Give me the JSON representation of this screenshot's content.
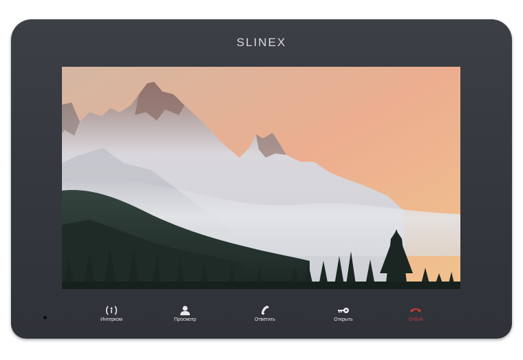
{
  "device": {
    "brand": "SLINEX",
    "body_color": "#36393f"
  },
  "screen": {
    "image": "mountain-landscape-wallpaper"
  },
  "buttons": [
    {
      "label": "Интерком",
      "icon": "intercom-icon",
      "color": "#e8e9ec"
    },
    {
      "label": "Просмотр",
      "icon": "user-icon",
      "color": "#e8e9ec"
    },
    {
      "label": "Ответить",
      "icon": "phone-icon",
      "color": "#e8e9ec"
    },
    {
      "label": "Открыть",
      "icon": "key-icon",
      "color": "#e8e9ec"
    },
    {
      "label": "Отбой",
      "icon": "hangup-icon",
      "color": "#c53a33"
    }
  ]
}
